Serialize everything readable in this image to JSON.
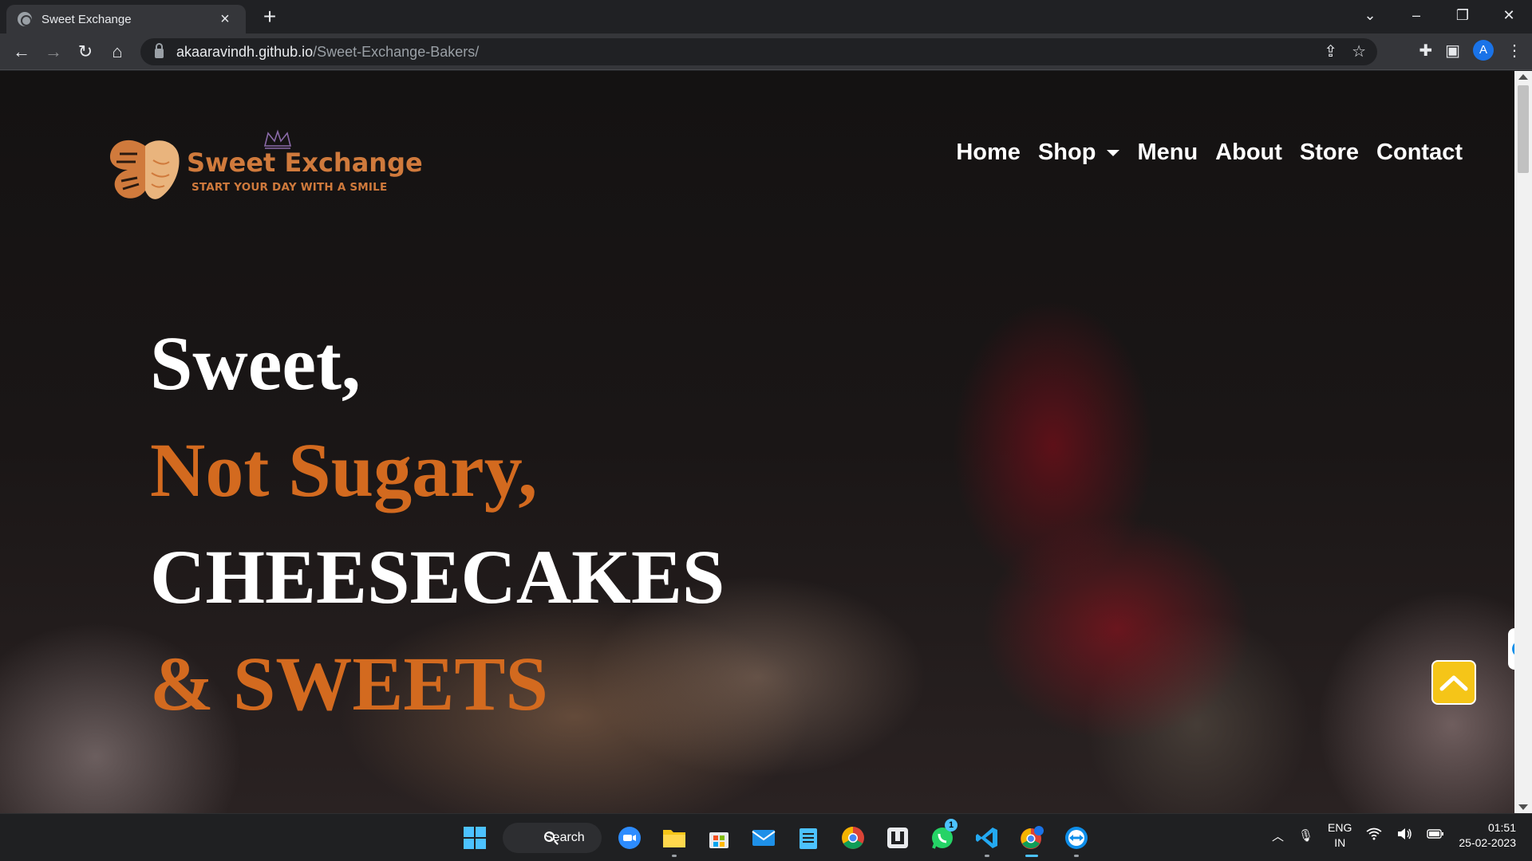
{
  "browser": {
    "tab_title": "Sweet Exchange",
    "url_host": "akaaravindh.github.io",
    "url_path": "/Sweet-Exchange-Bakers/",
    "profile_initial": "A"
  },
  "site": {
    "brand_name": "Sweet Exchange",
    "tagline": "START YOUR DAY WITH A SMILE",
    "brand_color": "#d07a3c",
    "nav": [
      {
        "label": "Home"
      },
      {
        "label": "Shop",
        "has_dropdown": true
      },
      {
        "label": "Menu"
      },
      {
        "label": "About"
      },
      {
        "label": "Store"
      },
      {
        "label": "Contact"
      }
    ],
    "hero": {
      "line1": "Sweet,",
      "line2": "Not Sugary,",
      "line3": "CHEESECAKES",
      "line4": "& SWEETS",
      "accent_color": "#d36a1f"
    },
    "back_to_top_icon": "chevron-up-icon",
    "back_to_top_color": "#f5c518"
  },
  "taskbar": {
    "search_label": "Search",
    "whatsapp_badge": "1",
    "language_line1": "ENG",
    "language_line2": "IN",
    "time": "01:51",
    "date": "25-02-2023",
    "pinned": [
      "windows-start-icon",
      "search",
      "zoom-icon",
      "file-explorer-icon",
      "microsoft-store-icon",
      "mail-icon",
      "notepad-icon",
      "chrome-icon",
      "app-icon",
      "whatsapp-icon",
      "vscode-icon",
      "chrome-profile-icon",
      "teamviewer-icon"
    ]
  }
}
